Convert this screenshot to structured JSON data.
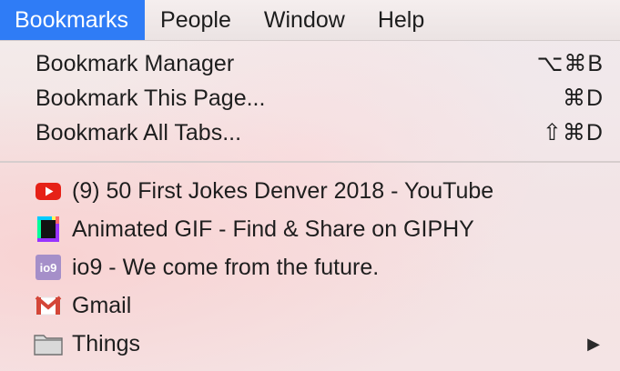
{
  "menubar": {
    "items": [
      {
        "label": "Bookmarks"
      },
      {
        "label": "People"
      },
      {
        "label": "Window"
      },
      {
        "label": "Help"
      }
    ]
  },
  "menu": {
    "commands": [
      {
        "label": "Bookmark Manager",
        "shortcut": "⌥⌘B"
      },
      {
        "label": "Bookmark This Page...",
        "shortcut": "⌘D"
      },
      {
        "label": "Bookmark All Tabs...",
        "shortcut": "⇧⌘D"
      }
    ],
    "bookmarks": [
      {
        "label": "(9) 50 First Jokes Denver 2018 - YouTube",
        "icon": "youtube-icon"
      },
      {
        "label": "Animated GIF - Find & Share on GIPHY",
        "icon": "giphy-icon"
      },
      {
        "label": "io9 - We come from the future.",
        "icon": "io9-icon",
        "icon_text": "io9"
      },
      {
        "label": "Gmail",
        "icon": "gmail-icon"
      },
      {
        "label": "Things",
        "icon": "folder-icon",
        "submenu_glyph": "▶"
      }
    ]
  },
  "colors": {
    "accent": "#2f7cf6",
    "youtube_red": "#e62117",
    "io9_purple": "#a58fc9",
    "gmail_red": "#d44638"
  }
}
